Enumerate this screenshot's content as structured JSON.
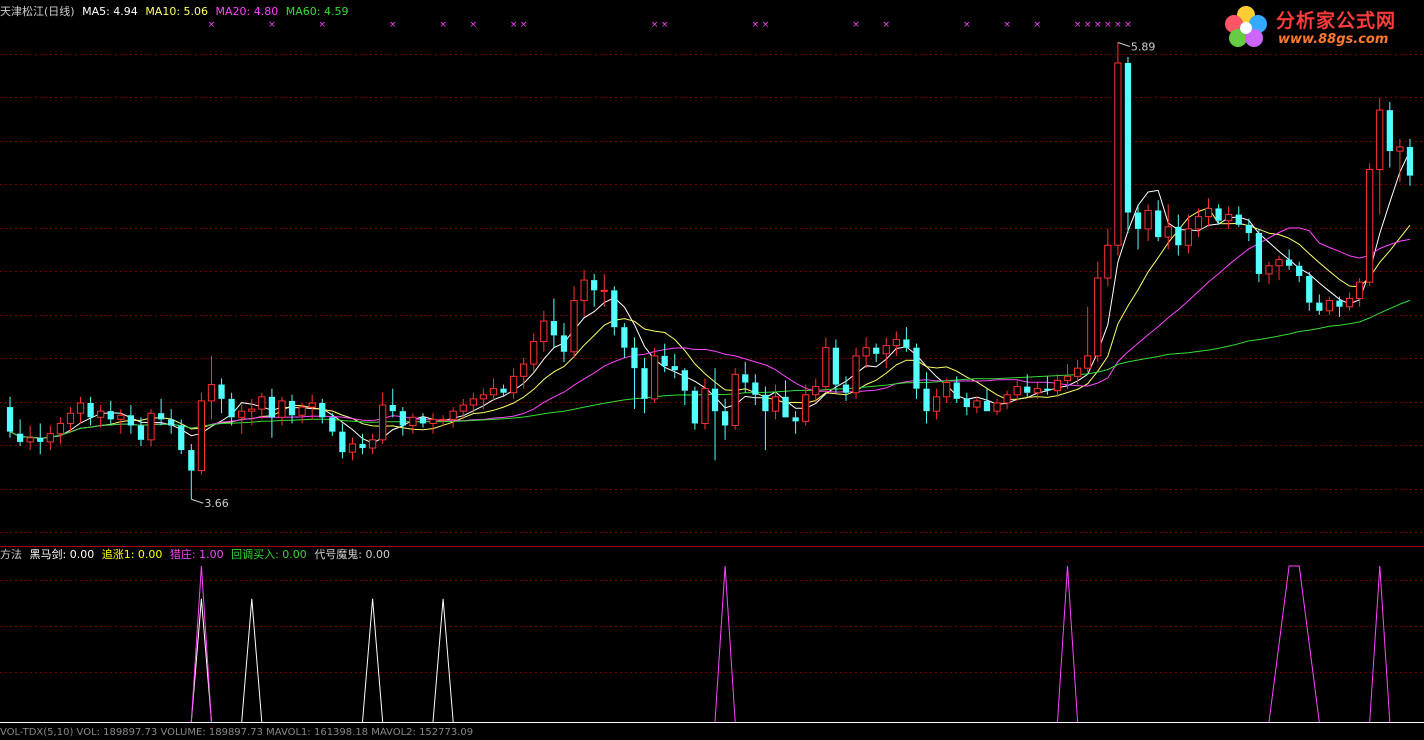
{
  "header": {
    "stock_name": "天津松江(日线)",
    "ma5_label": "MA5: 4.94",
    "ma10_label": "MA10: 5.06",
    "ma20_label": "MA20: 4.80",
    "ma60_label": "MA60: 4.59"
  },
  "indicator_header": {
    "method_label": "方法",
    "heima_label": "黑马剑: 0.00",
    "zhuizhang_label": "追涨1: 0.00",
    "liezhuang_label": "猎庄: 1.00",
    "huitiao_label": "回调买入: 0.00",
    "mogui_label": "代号魔鬼: 0.00"
  },
  "footer": {
    "text": "VOL-TDX(5,10) VOL: 189897.73  VOLUME: 189897.73  MAVOL1: 161398.18  MAVOL2: 152773.09"
  },
  "logo": {
    "name": "分析家公式网",
    "url": "www.88gs.com"
  },
  "colors": {
    "up": "#ff3030",
    "down": "#54ffff",
    "ma5": "#ffffff",
    "ma10": "#ffff66",
    "ma20": "#ff44ff",
    "ma60": "#33dd33",
    "grid": "#7a0000",
    "heima": "#ffffff",
    "zhuizhang": "#ffff00",
    "liezhuang": "#ff44ff",
    "huitiao": "#33dd33",
    "mogui": "#cccccc"
  },
  "chart_data": [
    {
      "type": "candlestick",
      "title": "天津松江(日线)",
      "ylim": [
        3.5,
        6.0
      ],
      "grid": true,
      "annotations": [
        {
          "text": "5.89",
          "index": 110,
          "price": 5.89
        },
        {
          "text": "3.66",
          "index": 18,
          "price": 3.66
        }
      ],
      "signal_markers": {
        "symbol": "×",
        "indices": [
          20,
          26,
          31,
          38,
          43,
          46,
          50,
          51,
          64,
          65,
          74,
          75,
          84,
          87,
          95,
          99,
          102,
          106,
          107,
          108,
          109,
          110,
          111
        ]
      },
      "ohlc": [
        [
          4.11,
          4.16,
          3.96,
          3.99
        ],
        [
          3.98,
          4.05,
          3.92,
          3.94
        ],
        [
          3.94,
          4.02,
          3.9,
          3.96
        ],
        [
          3.96,
          4.03,
          3.88,
          3.94
        ],
        [
          3.94,
          4.02,
          3.9,
          3.98
        ],
        [
          3.98,
          4.06,
          3.93,
          4.03
        ],
        [
          4.03,
          4.11,
          3.99,
          4.08
        ],
        [
          4.08,
          4.16,
          4.03,
          4.13
        ],
        [
          4.13,
          4.16,
          4.02,
          4.06
        ],
        [
          4.06,
          4.12,
          4.01,
          4.09
        ],
        [
          4.09,
          4.14,
          4.02,
          4.05
        ],
        [
          4.05,
          4.1,
          3.98,
          4.07
        ],
        [
          4.07,
          4.12,
          3.98,
          4.02
        ],
        [
          4.02,
          4.06,
          3.92,
          3.95
        ],
        [
          3.95,
          4.1,
          3.92,
          4.08
        ],
        [
          4.08,
          4.15,
          4.02,
          4.05
        ],
        [
          4.05,
          4.1,
          3.98,
          4.02
        ],
        [
          4.02,
          4.05,
          3.88,
          3.9
        ],
        [
          3.9,
          3.93,
          3.66,
          3.8
        ],
        [
          3.8,
          4.18,
          3.78,
          4.14
        ],
        [
          4.14,
          4.36,
          4.05,
          4.22
        ],
        [
          4.22,
          4.25,
          4.08,
          4.15
        ],
        [
          4.15,
          4.18,
          4.02,
          4.06
        ],
        [
          4.06,
          4.12,
          3.98,
          4.09
        ],
        [
          4.09,
          4.15,
          4.02,
          4.1
        ],
        [
          4.1,
          4.18,
          4.05,
          4.16
        ],
        [
          4.16,
          4.2,
          3.96,
          4.06
        ],
        [
          4.06,
          4.16,
          4.02,
          4.14
        ],
        [
          4.14,
          4.17,
          4.03,
          4.07
        ],
        [
          4.07,
          4.13,
          4.03,
          4.11
        ],
        [
          4.11,
          4.17,
          4.05,
          4.13
        ],
        [
          4.13,
          4.15,
          4.03,
          4.06
        ],
        [
          4.06,
          4.08,
          3.97,
          3.99
        ],
        [
          3.99,
          4.03,
          3.86,
          3.89
        ],
        [
          3.89,
          3.96,
          3.85,
          3.93
        ],
        [
          3.93,
          3.98,
          3.88,
          3.91
        ],
        [
          3.91,
          3.98,
          3.88,
          3.95
        ],
        [
          3.95,
          4.18,
          3.93,
          4.12
        ],
        [
          4.12,
          4.2,
          4.06,
          4.09
        ],
        [
          4.09,
          4.11,
          3.97,
          4.02
        ],
        [
          4.02,
          4.08,
          3.98,
          4.06
        ],
        [
          4.06,
          4.08,
          4.01,
          4.03
        ],
        [
          4.03,
          4.08,
          3.98,
          4.05
        ],
        [
          4.05,
          4.07,
          4.02,
          4.05
        ],
        [
          4.05,
          4.11,
          4.01,
          4.09
        ],
        [
          4.09,
          4.15,
          4.05,
          4.12
        ],
        [
          4.12,
          4.18,
          4.08,
          4.15
        ],
        [
          4.15,
          4.2,
          4.1,
          4.17
        ],
        [
          4.17,
          4.25,
          4.14,
          4.2
        ],
        [
          4.2,
          4.22,
          4.16,
          4.18
        ],
        [
          4.18,
          4.3,
          4.15,
          4.26
        ],
        [
          4.26,
          4.35,
          4.2,
          4.32
        ],
        [
          4.32,
          4.47,
          4.28,
          4.43
        ],
        [
          4.43,
          4.58,
          4.38,
          4.53
        ],
        [
          4.53,
          4.64,
          4.4,
          4.46
        ],
        [
          4.46,
          4.52,
          4.33,
          4.38
        ],
        [
          4.38,
          4.7,
          4.35,
          4.63
        ],
        [
          4.63,
          4.78,
          4.55,
          4.73
        ],
        [
          4.73,
          4.76,
          4.6,
          4.68
        ],
        [
          4.68,
          4.76,
          4.6,
          4.68
        ],
        [
          4.68,
          4.7,
          4.46,
          4.5
        ],
        [
          4.5,
          4.52,
          4.35,
          4.4
        ],
        [
          4.4,
          4.45,
          4.1,
          4.3
        ],
        [
          4.3,
          4.35,
          4.08,
          4.15
        ],
        [
          4.15,
          4.4,
          4.13,
          4.36
        ],
        [
          4.36,
          4.42,
          4.28,
          4.31
        ],
        [
          4.31,
          4.37,
          4.25,
          4.29
        ],
        [
          4.29,
          4.3,
          4.12,
          4.19
        ],
        [
          4.19,
          4.21,
          4.0,
          4.03
        ],
        [
          4.03,
          4.25,
          4.0,
          4.2
        ],
        [
          4.2,
          4.3,
          3.85,
          4.09
        ],
        [
          4.09,
          4.15,
          3.95,
          4.02
        ],
        [
          4.02,
          4.3,
          4.0,
          4.27
        ],
        [
          4.27,
          4.33,
          4.18,
          4.23
        ],
        [
          4.23,
          4.27,
          4.12,
          4.17
        ],
        [
          4.17,
          4.21,
          3.9,
          4.09
        ],
        [
          4.09,
          4.22,
          4.05,
          4.16
        ],
        [
          4.16,
          4.24,
          4.12,
          4.06
        ],
        [
          4.06,
          4.09,
          3.98,
          4.04
        ],
        [
          4.04,
          4.22,
          4.02,
          4.17
        ],
        [
          4.17,
          4.25,
          4.13,
          4.21
        ],
        [
          4.21,
          4.45,
          4.18,
          4.4
        ],
        [
          4.4,
          4.44,
          4.18,
          4.22
        ],
        [
          4.22,
          4.26,
          4.14,
          4.18
        ],
        [
          4.18,
          4.4,
          4.15,
          4.36
        ],
        [
          4.36,
          4.45,
          4.3,
          4.4
        ],
        [
          4.4,
          4.42,
          4.33,
          4.37
        ],
        [
          4.37,
          4.45,
          4.3,
          4.41
        ],
        [
          4.41,
          4.48,
          4.36,
          4.44
        ],
        [
          4.44,
          4.5,
          4.38,
          4.4
        ],
        [
          4.4,
          4.42,
          4.15,
          4.2
        ],
        [
          4.2,
          4.28,
          4.03,
          4.09
        ],
        [
          4.09,
          4.2,
          4.05,
          4.16
        ],
        [
          4.16,
          4.25,
          4.13,
          4.23
        ],
        [
          4.23,
          4.26,
          4.13,
          4.15
        ],
        [
          4.15,
          4.18,
          4.07,
          4.11
        ],
        [
          4.11,
          4.16,
          4.08,
          4.14
        ],
        [
          4.14,
          4.2,
          4.1,
          4.09
        ],
        [
          4.09,
          4.15,
          4.07,
          4.13
        ],
        [
          4.13,
          4.19,
          4.1,
          4.17
        ],
        [
          4.17,
          4.24,
          4.14,
          4.21
        ],
        [
          4.21,
          4.27,
          4.16,
          4.18
        ],
        [
          4.18,
          4.23,
          4.15,
          4.2
        ],
        [
          4.2,
          4.26,
          4.17,
          4.19
        ],
        [
          4.19,
          4.27,
          4.16,
          4.24
        ],
        [
          4.24,
          4.32,
          4.2,
          4.26
        ],
        [
          4.26,
          4.34,
          4.22,
          4.3
        ],
        [
          4.3,
          4.6,
          4.28,
          4.36
        ],
        [
          4.36,
          4.82,
          4.33,
          4.74
        ],
        [
          4.74,
          4.98,
          4.7,
          4.9
        ],
        [
          4.9,
          5.89,
          4.85,
          5.79
        ],
        [
          5.79,
          5.82,
          4.96,
          5.06
        ],
        [
          5.06,
          5.1,
          4.88,
          4.98
        ],
        [
          4.98,
          5.1,
          4.92,
          5.07
        ],
        [
          5.07,
          5.12,
          4.92,
          4.94
        ],
        [
          4.94,
          5.1,
          4.88,
          4.99
        ],
        [
          4.99,
          5.05,
          4.85,
          4.9
        ],
        [
          4.9,
          5.05,
          4.86,
          4.98
        ],
        [
          4.98,
          5.08,
          4.94,
          5.04
        ],
        [
          5.04,
          5.13,
          4.99,
          5.08
        ],
        [
          5.08,
          5.1,
          5.0,
          5.02
        ],
        [
          5.02,
          5.09,
          4.98,
          5.05
        ],
        [
          5.05,
          5.09,
          4.99,
          5.0
        ],
        [
          5.0,
          5.03,
          4.92,
          4.96
        ],
        [
          4.96,
          4.98,
          4.72,
          4.76
        ],
        [
          4.76,
          4.82,
          4.71,
          4.8
        ],
        [
          4.8,
          4.85,
          4.73,
          4.83
        ],
        [
          4.83,
          4.88,
          4.78,
          4.8
        ],
        [
          4.8,
          4.82,
          4.72,
          4.75
        ],
        [
          4.75,
          4.77,
          4.58,
          4.62
        ],
        [
          4.62,
          4.66,
          4.56,
          4.58
        ],
        [
          4.58,
          4.65,
          4.56,
          4.63
        ],
        [
          4.63,
          4.65,
          4.55,
          4.6
        ],
        [
          4.6,
          4.67,
          4.58,
          4.64
        ],
        [
          4.64,
          4.74,
          4.6,
          4.72
        ],
        [
          4.72,
          5.3,
          4.7,
          5.27
        ],
        [
          5.27,
          5.62,
          5.05,
          5.56
        ],
        [
          5.56,
          5.6,
          5.28,
          5.36
        ],
        [
          5.36,
          5.42,
          5.21,
          5.38
        ],
        [
          5.38,
          5.42,
          5.19,
          5.24
        ]
      ]
    },
    {
      "type": "line",
      "title": "方法",
      "ylim": [
        0,
        1
      ],
      "series": [
        {
          "name": "黑马剑",
          "segments": [
            [
              18,
              20
            ],
            [
              23,
              25
            ],
            [
              35,
              37
            ],
            [
              42,
              44
            ]
          ]
        },
        {
          "name": "猎庄",
          "segments": [
            [
              18,
              20
            ],
            [
              70,
              72
            ],
            [
              104,
              106
            ],
            [
              125,
              127,
              128,
              130
            ],
            [
              135,
              137
            ]
          ]
        }
      ]
    }
  ]
}
